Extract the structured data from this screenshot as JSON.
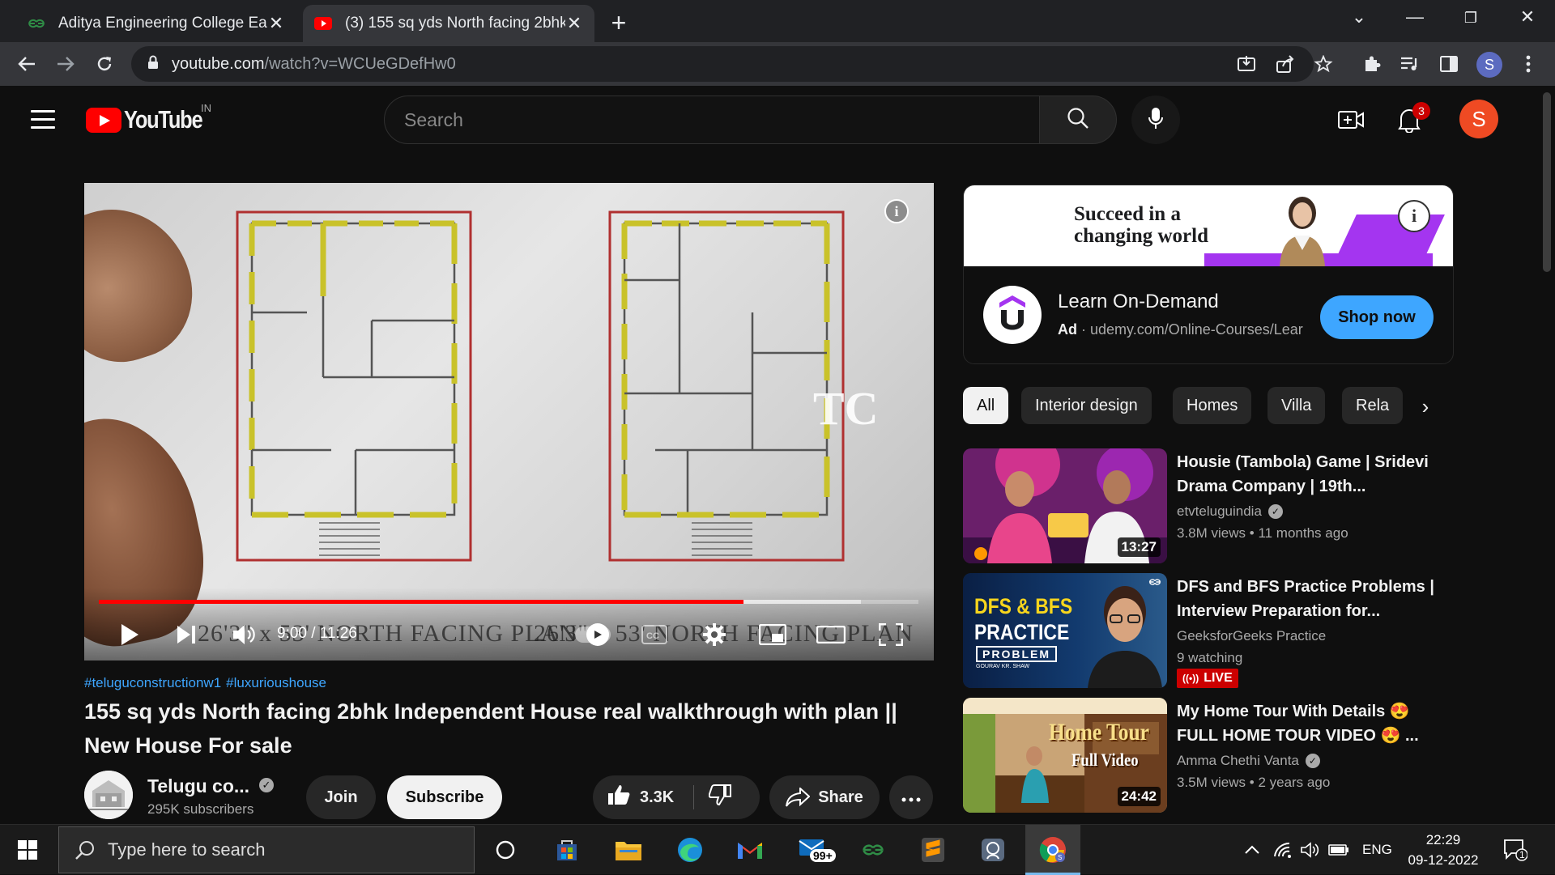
{
  "browser": {
    "tabs": [
      {
        "title": "Aditya Engineering College East G",
        "active": false,
        "icon": "geeksforgeeks-icon"
      },
      {
        "title": "(3) 155 sq yds North facing 2bhk",
        "active": true,
        "icon": "youtube-icon"
      }
    ],
    "url_host": "youtube.com",
    "url_path": "/watch?v=WCUeGDefHw0",
    "profile_initial": "S"
  },
  "youtube": {
    "logo_text": "YouTube",
    "country_code": "IN",
    "search_placeholder": "Search",
    "notification_count": "3",
    "avatar_initial": "S"
  },
  "player": {
    "time": "9:00 / 11:26",
    "progress_fraction": 0.787,
    "buffered_fraction": 0.93,
    "watermark": "TC",
    "plan_caption_left": "26'3\" x 53' NORTH FACING PLAN",
    "plan_caption_right": "26'3\" x 53' NORTH FACING PLAN"
  },
  "video": {
    "hashtags": [
      "#teluguconstructionw1",
      "#luxurioushouse"
    ],
    "title": "155 sq yds North facing 2bhk Independent House real walkthrough with plan || New House For sale",
    "channel": "Telugu co...",
    "subscribers": "295K subscribers",
    "join_label": "Join",
    "subscribe_label": "Subscribe",
    "likes": "3.3K",
    "share_label": "Share"
  },
  "ad": {
    "banner_line1": "Succeed in a",
    "banner_line2": "changing world",
    "title": "Learn On-Demand",
    "ad_label": "Ad",
    "ad_url": "udemy.com/Online-Courses/Lear",
    "cta": "Shop now",
    "accent": "#a435f0"
  },
  "chips": [
    "All",
    "Interior design",
    "Homes",
    "Villa",
    "Rela"
  ],
  "recommendations": [
    {
      "title": "Housie (Tambola) Game | Sridevi Drama Company | 19th...",
      "channel": "etvteluguindia",
      "verified": true,
      "views": "3.8M views",
      "age": "11 months ago",
      "duration": "13:27",
      "live": false
    },
    {
      "title": "DFS and BFS Practice Problems | Interview Preparation for...",
      "channel": "GeeksforGeeks Practice",
      "verified": false,
      "views": "9 watching",
      "age": "",
      "duration": "",
      "live": true,
      "live_label": "LIVE",
      "thumb_text_1": "DFS & BFS",
      "thumb_text_2": "PRACTICE",
      "thumb_text_3": "PROBLEM",
      "thumb_text_4": "GOURAV KR. SHAW"
    },
    {
      "title": "My Home Tour With Details 😍 FULL HOME TOUR VIDEO 😍 ...",
      "channel": "Amma Chethi Vanta",
      "verified": true,
      "views": "3.5M views",
      "age": "2 years ago",
      "duration": "24:42",
      "live": false,
      "thumb_text_1": "Home Tour",
      "thumb_text_2": "Full Video"
    }
  ],
  "taskbar": {
    "search_placeholder": "Type here to search",
    "mail_badge": "99+",
    "language": "ENG",
    "time": "22:29",
    "date": "09-12-2022",
    "notification_count": "1"
  }
}
